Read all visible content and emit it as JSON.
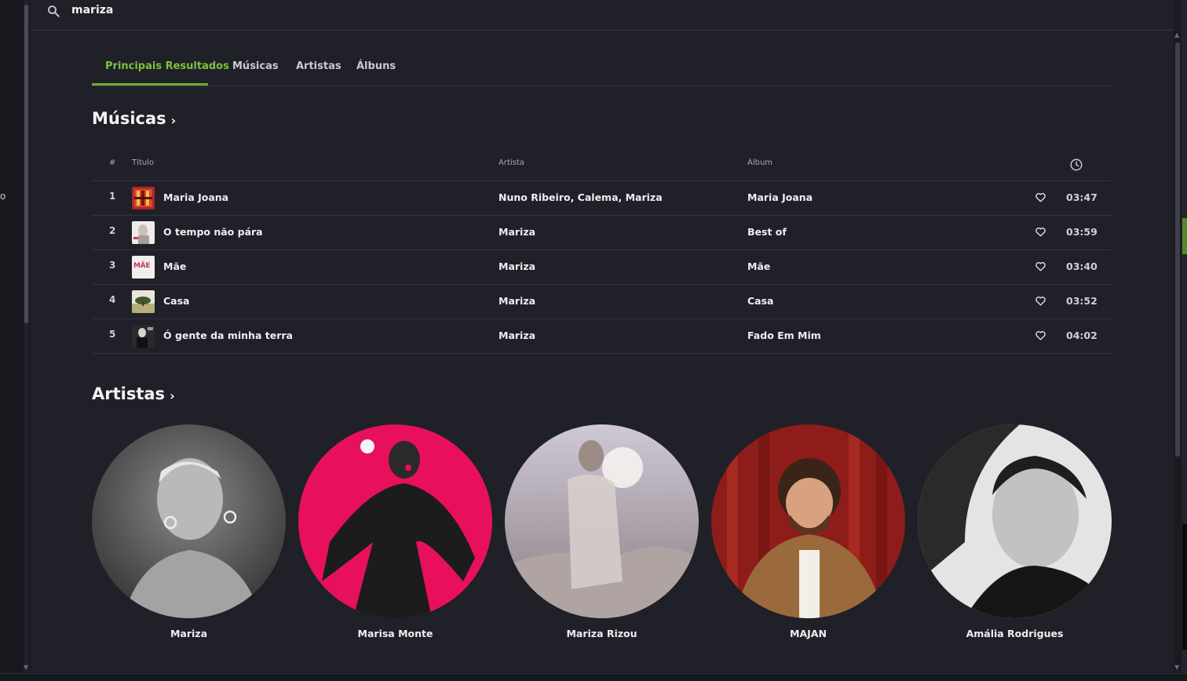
{
  "search": {
    "value": "mariza"
  },
  "left_stub": "o",
  "tabs": [
    {
      "label": "Principais Resultados",
      "active": true
    },
    {
      "label": "Músicas"
    },
    {
      "label": "Artistas"
    },
    {
      "label": "Álbuns"
    }
  ],
  "songs_section": {
    "title": "Músicas",
    "columns": {
      "num": "#",
      "title": "Título",
      "artist": "Artista",
      "album": "Álbum",
      "duration_icon": "clock-icon"
    },
    "rows": [
      {
        "num": "1",
        "title": "Maria Joana",
        "artist": "Nuno Ribeiro, Calema, Mariza",
        "album": "Maria Joana",
        "duration": "03:47"
      },
      {
        "num": "2",
        "title": "O tempo não pára",
        "artist": "Mariza",
        "album": "Best of",
        "duration": "03:59"
      },
      {
        "num": "3",
        "title": "Mãe",
        "artist": "Mariza",
        "album": "Mãe",
        "duration": "03:40"
      },
      {
        "num": "4",
        "title": "Casa",
        "artist": "Mariza",
        "album": "Casa",
        "duration": "03:52"
      },
      {
        "num": "5",
        "title": "Ó gente da minha terra",
        "artist": "Mariza",
        "album": "Fado Em Mim",
        "duration": "04:02"
      }
    ],
    "thumb_text_3": "MÃE"
  },
  "artists_section": {
    "title": "Artistas",
    "artists": [
      {
        "name": "Mariza"
      },
      {
        "name": "Marisa Monte"
      },
      {
        "name": "Mariza Rizou"
      },
      {
        "name": "MAJAN"
      },
      {
        "name": "Amália Rodrigues"
      }
    ]
  },
  "colors": {
    "accent": "#7fbf3f",
    "background": "#1f2028"
  }
}
